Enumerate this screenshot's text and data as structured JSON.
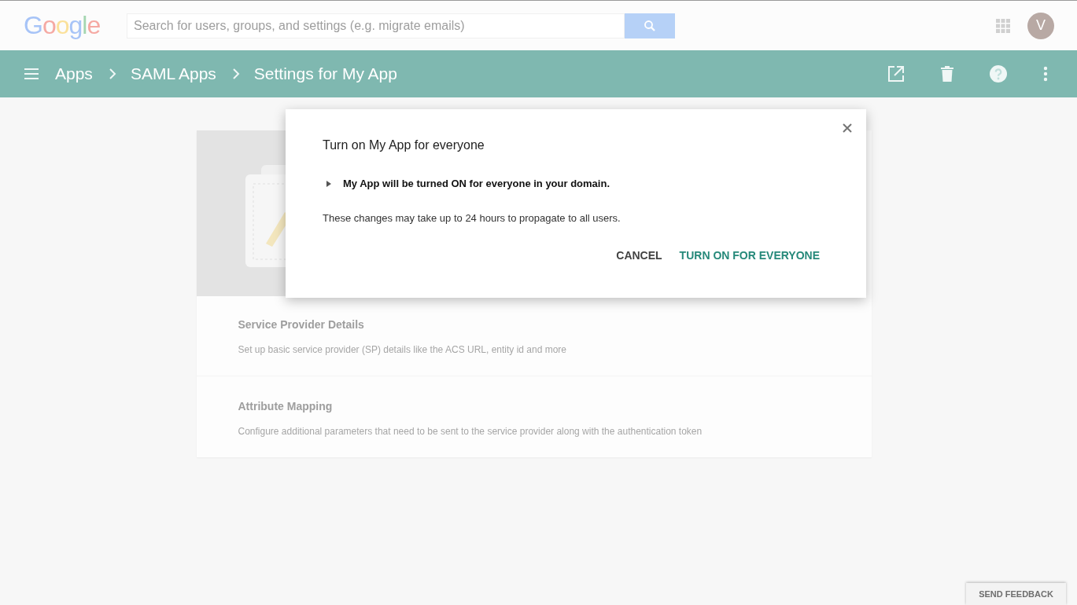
{
  "header": {
    "logo": "Google",
    "search": {
      "placeholder": "Search for users, groups, and settings (e.g. migrate emails)"
    },
    "avatar": "V"
  },
  "breadcrumb": [
    "Apps",
    "SAML Apps",
    "Settings for My App"
  ],
  "card": {
    "sections": [
      {
        "title": "Service Provider Details",
        "description": "Set up basic service provider (SP) details like the ACS URL, entity id and more"
      },
      {
        "title": "Attribute Mapping",
        "description": "Configure additional parameters that need to be sent to the service provider along with the authentication token"
      }
    ]
  },
  "dialog": {
    "title": "Turn on My App for everyone",
    "detail": {
      "text": "My App will be turned ON for everyone in your domain.",
      "expanded": false
    },
    "note": "These changes may take up to 24 hours to propagate to all users.",
    "buttons": [
      {
        "label": "CANCEL",
        "kind": "plain"
      },
      {
        "label": "TURN ON FOR EVERYONE",
        "kind": "primary"
      }
    ]
  },
  "feedback": "SEND FEEDBACK"
}
